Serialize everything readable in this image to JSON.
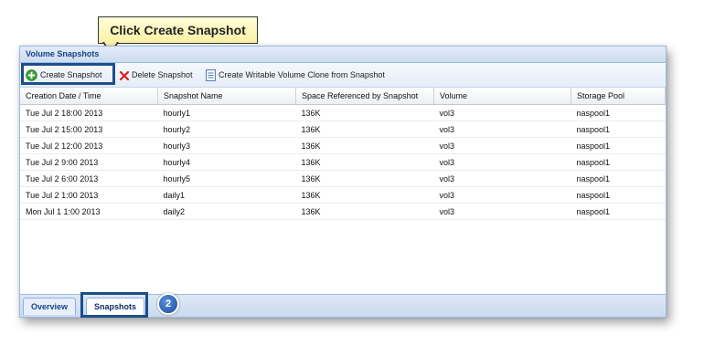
{
  "callout": {
    "text": "Click Create Snapshot"
  },
  "panel": {
    "title": "Volume Snapshots"
  },
  "toolbar": {
    "create_label": "Create Snapshot",
    "delete_label": "Delete Snapshot",
    "clone_label": "Create Writable Volume Clone from Snapshot",
    "icons": {
      "create": "add-circle-icon",
      "delete": "red-x-icon",
      "clone": "document-icon"
    }
  },
  "table": {
    "columns": [
      "Creation Date / Time",
      "Snapshot Name",
      "Space Referenced by Snapshot",
      "Volume",
      "Storage Pool"
    ],
    "rows": [
      [
        "Tue Jul 2 18:00 2013",
        "hourly1",
        "136K",
        "vol3",
        "naspool1"
      ],
      [
        "Tue Jul 2 15:00 2013",
        "hourly2",
        "136K",
        "vol3",
        "naspool1"
      ],
      [
        "Tue Jul 2 12:00 2013",
        "hourly3",
        "136K",
        "vol3",
        "naspool1"
      ],
      [
        "Tue Jul 2 9:00 2013",
        "hourly4",
        "136K",
        "vol3",
        "naspool1"
      ],
      [
        "Tue Jul 2 6:00 2013",
        "hourly5",
        "136K",
        "vol3",
        "naspool1"
      ],
      [
        "Tue Jul 2 1:00 2013",
        "daily1",
        "136K",
        "vol3",
        "naspool1"
      ],
      [
        "Mon Jul 1 1:00 2013",
        "daily2",
        "136K",
        "vol3",
        "naspool1"
      ]
    ]
  },
  "tabs": [
    {
      "label": "Overview"
    },
    {
      "label": "Snapshots"
    }
  ],
  "badge": {
    "text": "2"
  },
  "colors": {
    "highlight": "#1a4f8b",
    "header_text": "#15428b",
    "callout_bg": "#fbf1a6"
  }
}
